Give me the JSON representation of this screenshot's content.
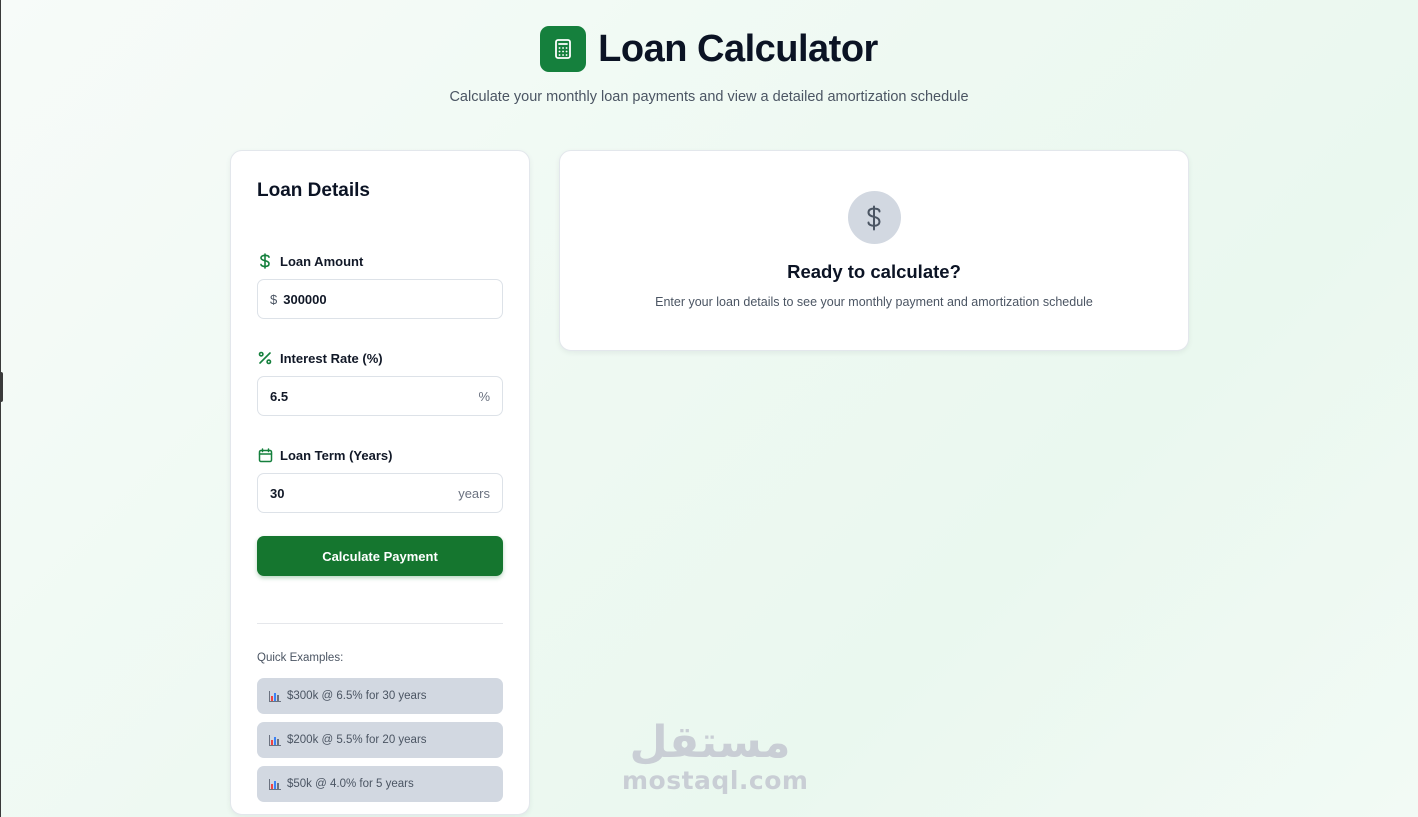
{
  "header": {
    "title": "Loan Calculator",
    "subtitle": "Calculate your monthly loan payments and view a detailed amortization schedule",
    "logo_icon": "calculator-icon"
  },
  "form": {
    "title": "Loan Details",
    "loan_amount": {
      "label": "Loan Amount",
      "icon": "dollar-icon",
      "prefix": "$",
      "value": "300000"
    },
    "interest_rate": {
      "label": "Interest Rate (%)",
      "icon": "percent-icon",
      "suffix": "%",
      "value": "6.5"
    },
    "loan_term": {
      "label": "Loan Term (Years)",
      "icon": "calendar-icon",
      "suffix": "years",
      "value": "30"
    },
    "calculate_label": "Calculate Payment",
    "quick_examples_label": "Quick Examples:",
    "examples": [
      {
        "label": "$300k @ 6.5% for 30 years",
        "icon": "bar-chart-icon"
      },
      {
        "label": "$200k @ 5.5% for 20 years",
        "icon": "bar-chart-icon"
      },
      {
        "label": "$50k @ 4.0% for 5 years",
        "icon": "bar-chart-icon"
      }
    ]
  },
  "result": {
    "icon": "dollar-icon",
    "title": "Ready to calculate?",
    "subtitle": "Enter your loan details to see your monthly payment and amortization schedule"
  },
  "watermark": {
    "arabic": "مستقل",
    "latin": "mostaql.com"
  },
  "colors": {
    "accent": "#15803d",
    "button": "#15762f",
    "muted_chip": "#d2d8e1"
  }
}
